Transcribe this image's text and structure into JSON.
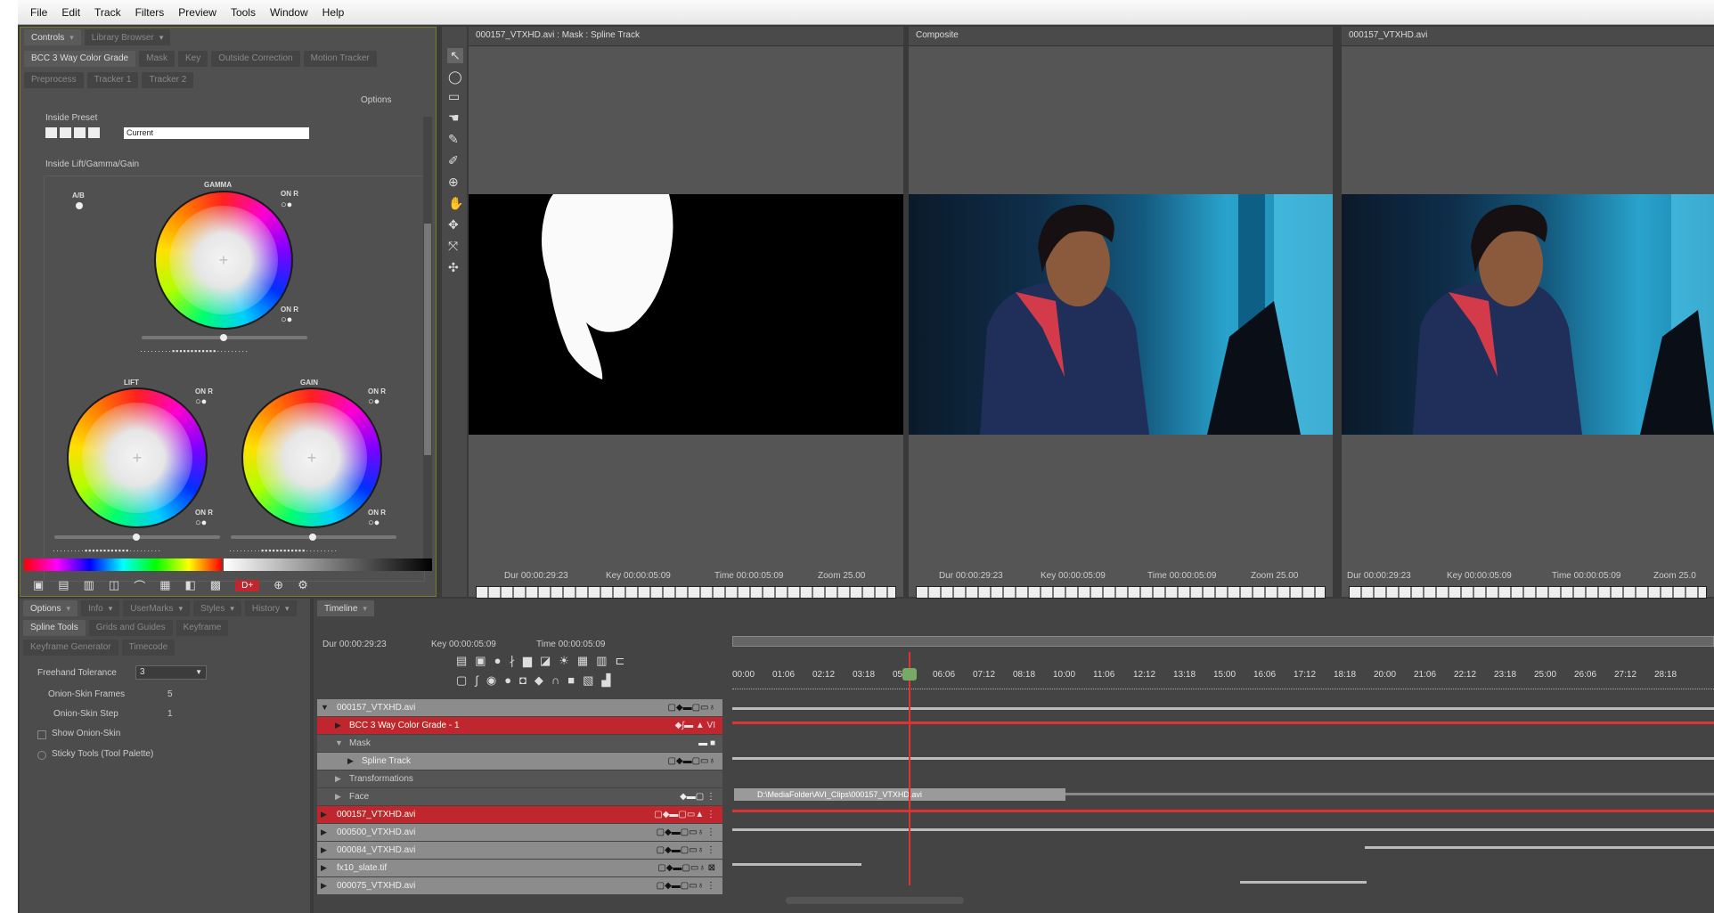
{
  "menu": [
    "File",
    "Edit",
    "Track",
    "Filters",
    "Preview",
    "Tools",
    "Window",
    "Help"
  ],
  "controls": {
    "tabs": [
      "Controls",
      "Library Browser"
    ],
    "effect_tabs_row1": [
      "BCC 3 Way Color Grade",
      "Mask",
      "Key",
      "Outside Correction",
      "Motion Tracker"
    ],
    "effect_tabs_row2": [
      "Preprocess",
      "Tracker 1",
      "Tracker 2"
    ],
    "options_label": "Options",
    "inside_preset_label": "Inside Preset",
    "preset_value": "Current",
    "lgg_label": "Inside Lift/Gamma/Gain",
    "gamma_label": "GAMMA",
    "lift_label": "LIFT",
    "gain_label": "GAIN",
    "ab_label": "A/B",
    "onr_label": "ON R",
    "remove_button": "D+"
  },
  "options_panel": {
    "tabs": [
      "Options",
      "Info",
      "UserMarks",
      "Styles",
      "History"
    ],
    "subtabs": [
      "Spline Tools",
      "Grids and Guides",
      "Keyframe"
    ],
    "subtabs2": [
      "Keyframe Generator",
      "Timecode"
    ],
    "freehand_label": "Freehand Tolerance",
    "freehand_value": "3",
    "onion_frames_label": "Onion-Skin Frames",
    "onion_frames_value": "5",
    "onion_step_label": "Onion-Skin Step",
    "onion_step_value": "1",
    "show_onion_label": "Show Onion-Skin",
    "sticky_label": "Sticky Tools (Tool Palette)"
  },
  "viewers": [
    {
      "title": "000157_VTXHD.avi : Mask : Spline Track",
      "dur": "Dur  00:00:29:23",
      "key": "Key  00:00:05:09",
      "time": "Time  00:00:05:09",
      "zoom": "Zoom  25.00"
    },
    {
      "title": "Composite",
      "dur": "Dur  00:00:29:23",
      "key": "Key  00:00:05:09",
      "time": "Time  00:00:05:09",
      "zoom": "Zoom  25.00"
    },
    {
      "title": "000157_VTXHD.avi",
      "dur": "Dur  00:00:29:23",
      "key": "Key  00:00:05:09",
      "time": "Time  00:00:05:09",
      "zoom": "Zoom  25.0"
    }
  ],
  "timeline": {
    "tab": "Timeline",
    "dur": "Dur  00:00:29:23",
    "key": "Key  00:00:05:09",
    "time": "Time  00:00:05:09",
    "ruler": [
      "00:00",
      "01:06",
      "02:12",
      "03:18",
      "05:00",
      "06:06",
      "07:12",
      "08:18",
      "10:00",
      "11:06",
      "12:12",
      "13:18",
      "15:00",
      "16:06",
      "17:12",
      "18:18",
      "20:00",
      "21:06",
      "22:12",
      "23:18",
      "25:00",
      "26:06",
      "27:12",
      "28:18"
    ],
    "clip_label": "D:\\MediaFolder\\AVI_Clips\\000157_VTXHD.avi",
    "tracks": [
      {
        "label": "000157_VTXHD.avi",
        "style": "grey",
        "indent": 0
      },
      {
        "label": "BCC 3 Way Color Grade - 1",
        "style": "red",
        "indent": 1
      },
      {
        "label": "Mask",
        "style": "dark",
        "indent": 1
      },
      {
        "label": "Spline Track",
        "style": "grey",
        "indent": 2
      },
      {
        "label": "Transformations",
        "style": "dark",
        "indent": 1
      },
      {
        "label": "Face",
        "style": "dark",
        "indent": 1
      },
      {
        "label": "000157_VTXHD.avi",
        "style": "red",
        "indent": 0
      },
      {
        "label": "000500_VTXHD.avi",
        "style": "grey",
        "indent": 0
      },
      {
        "label": "000084_VTXHD.avi",
        "style": "grey",
        "indent": 0
      },
      {
        "label": "fx10_slate.tif",
        "style": "grey",
        "indent": 0
      },
      {
        "label": "000075_VTXHD.avi",
        "style": "grey",
        "indent": 0
      }
    ]
  }
}
